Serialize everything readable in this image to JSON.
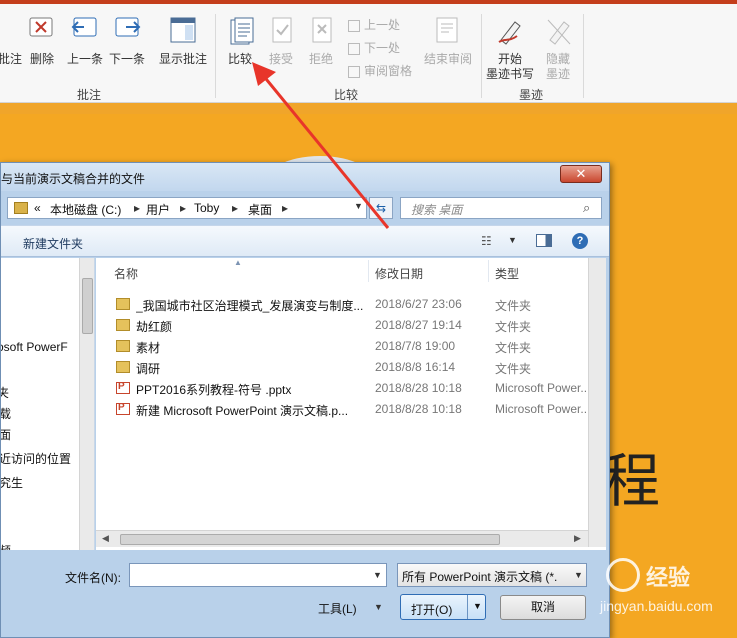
{
  "ribbon": {
    "groups": [
      {
        "label": "批注"
      },
      {
        "label": "比较"
      },
      {
        "label": "墨迹"
      }
    ],
    "annotate_buttons": [
      "批注",
      "删除",
      "上一条",
      "下一条",
      "显示批注"
    ],
    "compare_buttons": [
      "比较",
      "接受",
      "拒绝"
    ],
    "compare_small": [
      "上一处",
      "下一处",
      "审阅窗格"
    ],
    "end_review": "结束审阅",
    "ink_buttons": [
      {
        "line1": "开始",
        "line2": "墨迹书写"
      },
      {
        "line1": "隐藏",
        "line2": "墨迹"
      }
    ]
  },
  "slide": {
    "visible_text": "程"
  },
  "dialog": {
    "title": "与当前演示文稿合并的文件",
    "close": "✕",
    "address": {
      "nav_back": "«",
      "crumbs": [
        "本地磁盘 (C:)",
        "用户",
        "Toby",
        "桌面"
      ],
      "separator": "▸"
    },
    "search_placeholder": "搜索 桌面",
    "toolbar": {
      "new_folder": "新建文件夹",
      "view_icon": "view-list-icon",
      "help": "?"
    },
    "nav_items": [
      "rosoft PowerF",
      "夹",
      "载",
      "面",
      "近访问的位置",
      "究生",
      "频",
      "片",
      "档"
    ],
    "columns": {
      "name": "名称",
      "date": "修改日期",
      "type": "类型"
    },
    "files": [
      {
        "name": "_我国城市社区治理模式_发展演变与制度...",
        "date": "2018/6/27 23:06",
        "type": "文件夹",
        "icon": "folder-icon"
      },
      {
        "name": "劫红颜",
        "date": "2018/8/27 19:14",
        "type": "文件夹",
        "icon": "folder-icon"
      },
      {
        "name": "素材",
        "date": "2018/7/8 19:00",
        "type": "文件夹",
        "icon": "folder-icon"
      },
      {
        "name": "调研",
        "date": "2018/8/8 16:14",
        "type": "文件夹",
        "icon": "folder-icon"
      },
      {
        "name": "PPT2016系列教程-符号 .pptx",
        "date": "2018/8/28 10:18",
        "type": "Microsoft Power...",
        "icon": "pptx-icon"
      },
      {
        "name": "新建 Microsoft PowerPoint 演示文稿.p...",
        "date": "2018/8/28 10:18",
        "type": "Microsoft Power...",
        "icon": "pptx-icon"
      }
    ],
    "filename_label": "文件名(N):",
    "filename_value": "",
    "filetype_value": "所有 PowerPoint 演示文稿 (*.",
    "tools_label": "工具(L)",
    "open_label": "打开(O)",
    "cancel_label": "取消"
  },
  "watermark": {
    "text": "经验",
    "url": "jingyan.baidu.com"
  },
  "colors": {
    "ribbon_accent": "#c43e1c",
    "slide_bg": "#f4a722",
    "arrow": "#e8352a",
    "dialog_frame": "#b9d1ea"
  }
}
